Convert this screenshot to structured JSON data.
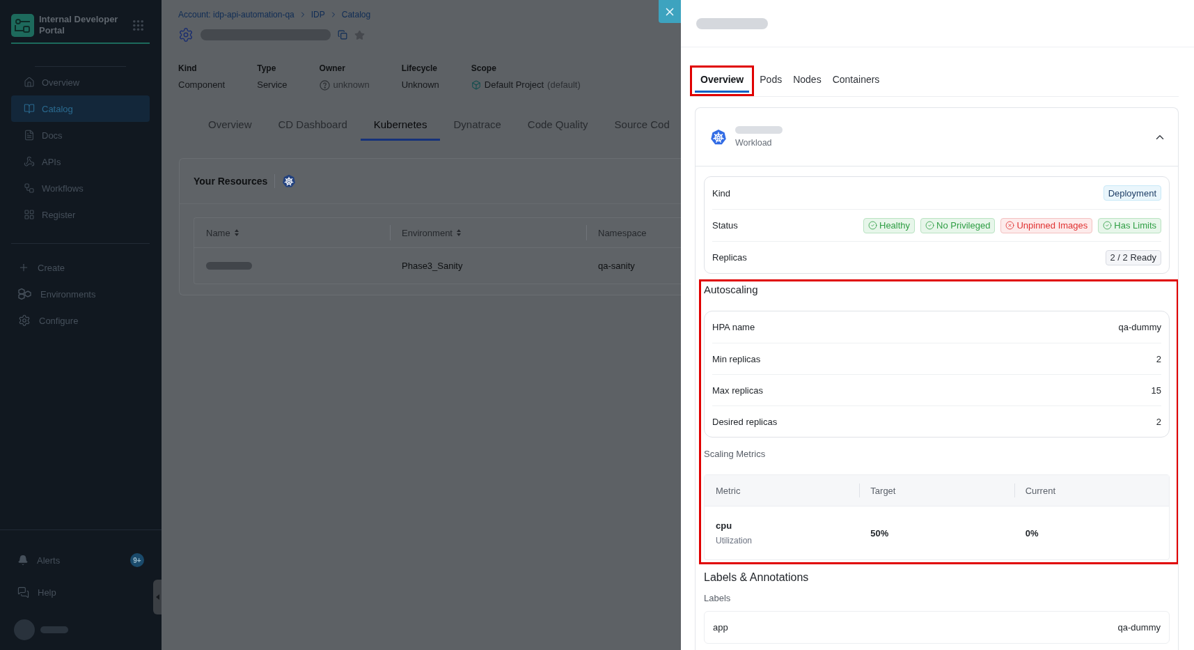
{
  "sidebar": {
    "app_name": "Internal Developer Portal",
    "nav": [
      {
        "label": "Overview",
        "selected": false
      },
      {
        "label": "Catalog",
        "selected": true
      },
      {
        "label": "Docs",
        "selected": false
      },
      {
        "label": "APIs",
        "selected": false
      },
      {
        "label": "Workflows",
        "selected": false
      },
      {
        "label": "Register",
        "selected": false
      }
    ],
    "actions": [
      {
        "label": "Create"
      },
      {
        "label": "Environments"
      },
      {
        "label": "Configure"
      }
    ],
    "footer": [
      {
        "label": "Alerts",
        "badge": "9+"
      },
      {
        "label": "Help"
      }
    ]
  },
  "main": {
    "breadcrumb": [
      "Account: idp-api-automation-qa",
      "IDP",
      "Catalog"
    ],
    "metadata": [
      {
        "label": "Kind",
        "value": "Component",
        "kind": "plain"
      },
      {
        "label": "Type",
        "value": "Service",
        "kind": "plain"
      },
      {
        "label": "Owner",
        "value": "unknown",
        "kind": "unknown"
      },
      {
        "label": "Lifecycle",
        "value": "Unknown",
        "kind": "plain"
      },
      {
        "label": "Scope",
        "value": "Default Project",
        "note": "(default)",
        "kind": "project"
      }
    ],
    "tabs": [
      {
        "label": "Overview",
        "selected": false
      },
      {
        "label": "CD Dashboard",
        "selected": false
      },
      {
        "label": "Kubernetes",
        "selected": true
      },
      {
        "label": "Dynatrace",
        "selected": false
      },
      {
        "label": "Code Quality",
        "selected": false
      },
      {
        "label": "Source Cod",
        "selected": false
      }
    ],
    "resources": {
      "title": "Your Resources",
      "columns": [
        {
          "label": "Name",
          "sortable": true
        },
        {
          "label": "Environment",
          "sortable": true
        },
        {
          "label": "Namespace",
          "sortable": false
        }
      ],
      "rows": [
        {
          "environment": "Phase3_Sanity",
          "namespace": "qa-sanity"
        }
      ]
    }
  },
  "drawer": {
    "tabs": [
      {
        "label": "Overview",
        "selected": true,
        "highlighted": true
      },
      {
        "label": "Pods",
        "selected": false,
        "highlighted": false
      },
      {
        "label": "Nodes",
        "selected": false,
        "highlighted": false
      },
      {
        "label": "Containers",
        "selected": false,
        "highlighted": false
      }
    ],
    "workload": {
      "subtitle": "Workload",
      "expanded": true,
      "details": [
        {
          "label": "Kind",
          "badges": [
            {
              "text": "Deployment",
              "kind": "info"
            }
          ]
        },
        {
          "label": "Status",
          "badges": [
            {
              "text": "Healthy",
              "kind": "ok"
            },
            {
              "text": "No Privileged",
              "kind": "ok"
            },
            {
              "text": "Unpinned Images",
              "kind": "error"
            },
            {
              "text": "Has Limits",
              "kind": "ok"
            }
          ]
        },
        {
          "label": "Replicas",
          "badges": [
            {
              "text": "2 / 2 Ready",
              "kind": "neutral"
            }
          ]
        }
      ]
    },
    "autoscaling": {
      "title": "Autoscaling",
      "highlighted": true,
      "fields": [
        {
          "label": "HPA name",
          "value": "qa-dummy"
        },
        {
          "label": "Min replicas",
          "value": "2"
        },
        {
          "label": "Max replicas",
          "value": "15"
        },
        {
          "label": "Desired replicas",
          "value": "2"
        }
      ],
      "metrics_title": "Scaling Metrics",
      "metrics_columns": [
        "Metric",
        "Target",
        "Current"
      ],
      "metrics": [
        {
          "name": "cpu",
          "type": "Utilization",
          "target": "50%",
          "current": "0%"
        }
      ]
    },
    "labels_section": {
      "title": "Labels & Annotations",
      "subtitle": "Labels",
      "labels": [
        {
          "key": "app",
          "value": "qa-dummy"
        }
      ]
    }
  }
}
